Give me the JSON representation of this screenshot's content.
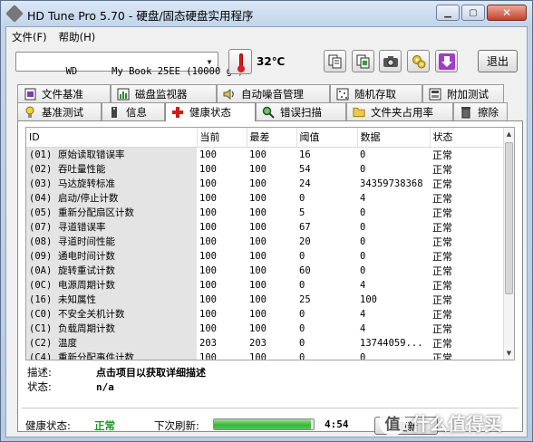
{
  "window": {
    "title": "HD Tune Pro 5.70 - 硬盘/固态硬盘实用程序"
  },
  "menu": {
    "items": [
      "文件(F)",
      "帮助(H)"
    ]
  },
  "toolbar": {
    "drive": "WD      My Book 25EE (10000 gB)",
    "temperature": "32℃",
    "exit_label": "退出",
    "icons": [
      "copy-text-icon",
      "copy-screenshot-icon",
      "camera-icon",
      "options-icon",
      "download-icon"
    ]
  },
  "tabs": {
    "top": [
      {
        "label": "文件基准",
        "icon": "file-benchmark-icon"
      },
      {
        "label": "磁盘监视器",
        "icon": "disk-monitor-icon"
      },
      {
        "label": "自动噪音管理",
        "icon": "speaker-icon"
      },
      {
        "label": "随机存取",
        "icon": "random-access-icon"
      },
      {
        "label": "附加测试",
        "icon": "extra-tests-icon"
      }
    ],
    "bottom": [
      {
        "label": "基准测试",
        "icon": "lightbulb-icon"
      },
      {
        "label": "信息",
        "icon": "info-icon"
      },
      {
        "label": "健康状态",
        "icon": "health-cross-icon",
        "active": true
      },
      {
        "label": "错误扫描",
        "icon": "magnifier-icon"
      },
      {
        "label": "文件夹占用率",
        "icon": "folder-icon"
      },
      {
        "label": "擦除",
        "icon": "trash-icon"
      }
    ]
  },
  "smart_table": {
    "headers": [
      "ID",
      "当前",
      "最差",
      "阈值",
      "数据",
      "状态"
    ],
    "rows": [
      {
        "code": "(01)",
        "name": "原始读取错误率",
        "current": "100",
        "worst": "100",
        "threshold": "16",
        "data": "0",
        "status": "正常"
      },
      {
        "code": "(02)",
        "name": "吞吐量性能",
        "current": "100",
        "worst": "100",
        "threshold": "54",
        "data": "0",
        "status": "正常"
      },
      {
        "code": "(03)",
        "name": "马达旋转标准",
        "current": "100",
        "worst": "100",
        "threshold": "24",
        "data": "34359738368",
        "status": "正常"
      },
      {
        "code": "(04)",
        "name": "启动/停止计数",
        "current": "100",
        "worst": "100",
        "threshold": "0",
        "data": "4",
        "status": "正常"
      },
      {
        "code": "(05)",
        "name": "重新分配扇区计数",
        "current": "100",
        "worst": "100",
        "threshold": "5",
        "data": "0",
        "status": "正常"
      },
      {
        "code": "(07)",
        "name": "寻道错误率",
        "current": "100",
        "worst": "100",
        "threshold": "67",
        "data": "0",
        "status": "正常"
      },
      {
        "code": "(08)",
        "name": "寻道时间性能",
        "current": "100",
        "worst": "100",
        "threshold": "20",
        "data": "0",
        "status": "正常"
      },
      {
        "code": "(09)",
        "name": "通电时间计数",
        "current": "100",
        "worst": "100",
        "threshold": "0",
        "data": "0",
        "status": "正常"
      },
      {
        "code": "(0A)",
        "name": "旋转重试计数",
        "current": "100",
        "worst": "100",
        "threshold": "60",
        "data": "0",
        "status": "正常"
      },
      {
        "code": "(0C)",
        "name": "电源周期计数",
        "current": "100",
        "worst": "100",
        "threshold": "0",
        "data": "4",
        "status": "正常"
      },
      {
        "code": "(16)",
        "name": "未知属性",
        "current": "100",
        "worst": "100",
        "threshold": "25",
        "data": "100",
        "status": "正常"
      },
      {
        "code": "(C0)",
        "name": "不安全关机计数",
        "current": "100",
        "worst": "100",
        "threshold": "0",
        "data": "4",
        "status": "正常"
      },
      {
        "code": "(C1)",
        "name": "负载周期计数",
        "current": "100",
        "worst": "100",
        "threshold": "0",
        "data": "4",
        "status": "正常"
      },
      {
        "code": "(C2)",
        "name": "温度",
        "current": "203",
        "worst": "203",
        "threshold": "0",
        "data": "13744059...",
        "status": "正常"
      },
      {
        "code": "(C4)",
        "name": "重新分配事件计数",
        "current": "100",
        "worst": "100",
        "threshold": "0",
        "data": "0",
        "status": "正常"
      }
    ]
  },
  "details": {
    "desc_label": "描述:",
    "desc_value": "点击项目以获取详细描述",
    "state_label": "状态:",
    "state_value": "n/a"
  },
  "status_bar": {
    "health_label": "健康状态:",
    "health_value": "正常",
    "refresh_label": "下次刷新:",
    "refresh_progress": 0.97,
    "timer": "4:54",
    "update_label": "更新"
  },
  "watermark": {
    "text": "值 什么值得买"
  },
  "colors": {
    "health_ok": "#1a9a1a",
    "progress_fill": "#3cb43a",
    "close_button": "#c7402a",
    "thermometer": "#d81e1e",
    "download_purple": "#a13bc9"
  }
}
